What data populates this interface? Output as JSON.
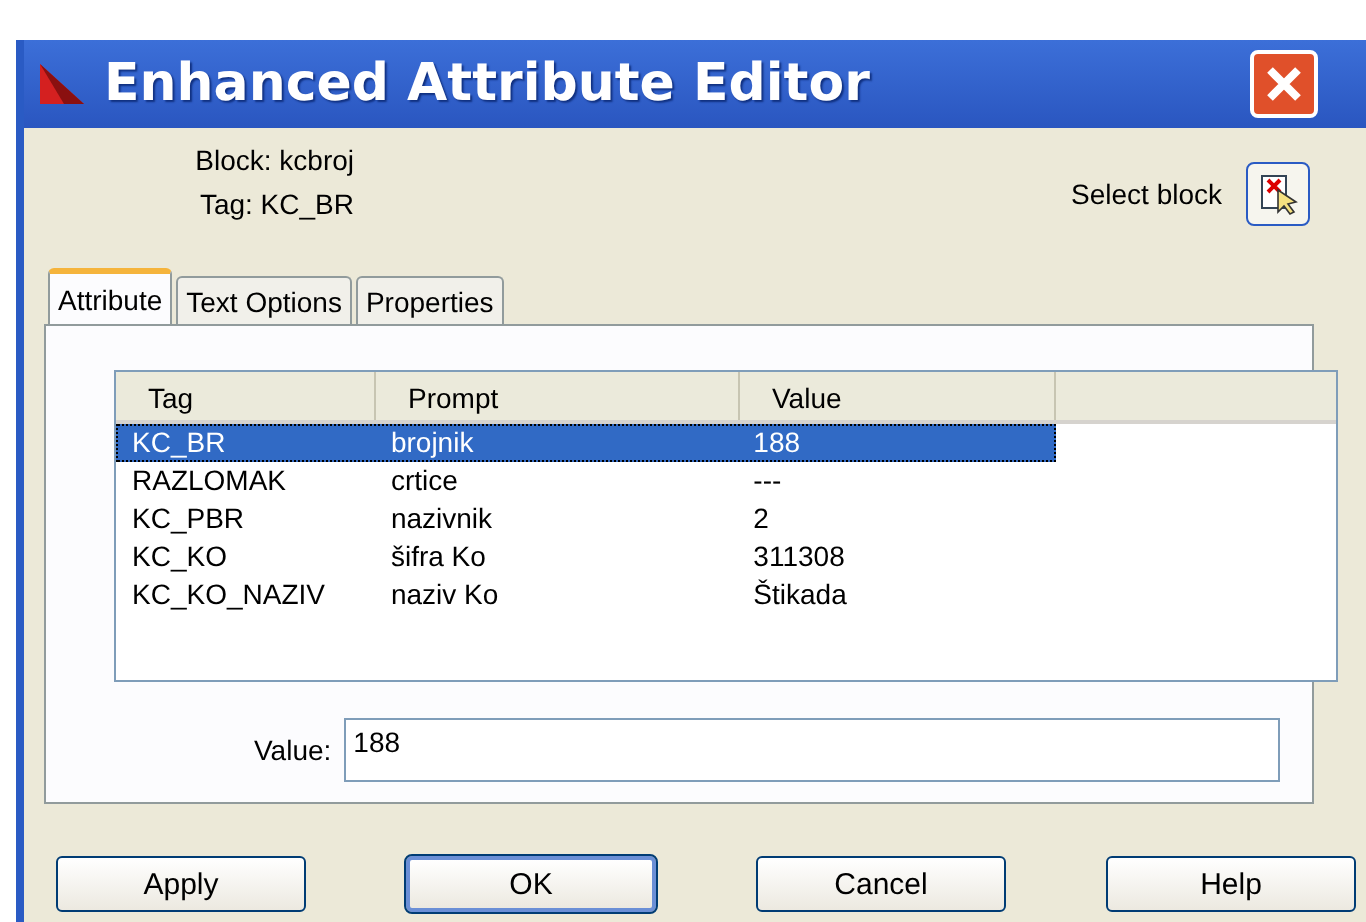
{
  "window": {
    "title": "Enhanced Attribute Editor"
  },
  "info": {
    "block": "Block: kcbroj",
    "tag": "Tag: KC_BR",
    "select_label": "Select block"
  },
  "tabs": [
    {
      "label": "Attribute",
      "selected": true
    },
    {
      "label": "Text Options",
      "selected": false
    },
    {
      "label": "Properties",
      "selected": false
    }
  ],
  "table": {
    "columns": [
      "Tag",
      "Prompt",
      "Value"
    ],
    "rows": [
      {
        "cells": [
          "KC_BR",
          "brojnik",
          "188"
        ],
        "selected": true
      },
      {
        "cells": [
          "RAZLOMAK",
          "crtice",
          "---"
        ],
        "selected": false
      },
      {
        "cells": [
          "KC_PBR",
          "nazivnik",
          "2"
        ],
        "selected": false
      },
      {
        "cells": [
          "KC_KO",
          "šifra Ko",
          "311308"
        ],
        "selected": false
      },
      {
        "cells": [
          "KC_KO_NAZIV",
          "naziv Ko",
          "Štikada"
        ],
        "selected": false
      }
    ]
  },
  "value_field": {
    "label": "Value:",
    "value": "188"
  },
  "buttons": [
    {
      "label": "Apply",
      "default": false
    },
    {
      "label": "OK",
      "default": true
    },
    {
      "label": "Cancel",
      "default": false
    },
    {
      "label": "Help",
      "default": false
    }
  ]
}
